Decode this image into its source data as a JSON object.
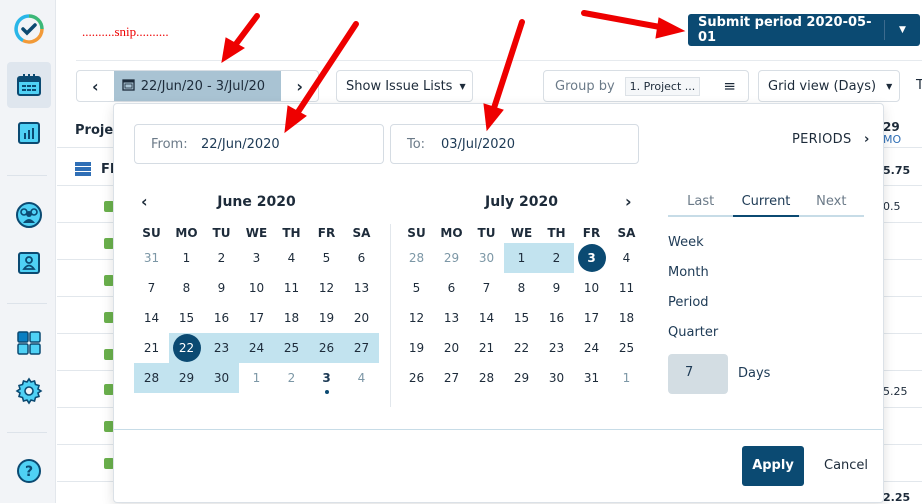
{
  "sidebar": {
    "items": [
      {
        "name": "logo",
        "icon": "check-circle-logo"
      },
      {
        "name": "calendar",
        "icon": "calendar-icon",
        "active": true
      },
      {
        "name": "reports",
        "icon": "bar-chart-icon"
      },
      {
        "name": "teams",
        "icon": "team-icon"
      },
      {
        "name": "profile",
        "icon": "user-card-icon"
      },
      {
        "name": "apps",
        "icon": "grid-icon"
      },
      {
        "name": "settings",
        "icon": "gear-icon"
      },
      {
        "name": "help",
        "icon": "help-icon"
      }
    ]
  },
  "annotation": {
    "snip": "..........snip.........."
  },
  "header": {
    "submit_label": "Submit period 2020-05-01"
  },
  "toolbar": {
    "date_range": "22/Jun/20 - 3/Jul/20",
    "show_issue_lists": "Show Issue Lists",
    "group_by_label": "Group by",
    "group_by_value": "1. Project ...",
    "grid_view": "Grid view (Days)",
    "truncated": "T"
  },
  "table": {
    "header_project": "Projec",
    "row_group": "FI",
    "col_header_day": "29",
    "col_header_dow": "MO",
    "values": [
      "5.75",
      "0.5",
      "5.25",
      "2.25"
    ]
  },
  "popup": {
    "from_label": "From:",
    "from_value": "22/Jun/2020",
    "to_label": "To:",
    "to_value": "03/Jul/2020",
    "periods_label": "PERIODS",
    "weekdays": [
      "SU",
      "MO",
      "TU",
      "WE",
      "TH",
      "FR",
      "SA"
    ],
    "left_month": "June 2020",
    "right_month": "July 2020",
    "left_days": [
      [
        "31",
        "1",
        "2",
        "3",
        "4",
        "5",
        "6"
      ],
      [
        "7",
        "8",
        "9",
        "10",
        "11",
        "12",
        "13"
      ],
      [
        "14",
        "15",
        "16",
        "17",
        "18",
        "19",
        "20"
      ],
      [
        "21",
        "22",
        "23",
        "24",
        "25",
        "26",
        "27"
      ],
      [
        "28",
        "29",
        "30",
        "1",
        "2",
        "3",
        "4"
      ]
    ],
    "right_days": [
      [
        "28",
        "29",
        "30",
        "1",
        "2",
        "3",
        "4"
      ],
      [
        "5",
        "6",
        "7",
        "8",
        "9",
        "10",
        "11"
      ],
      [
        "12",
        "13",
        "14",
        "15",
        "16",
        "17",
        "18"
      ],
      [
        "19",
        "20",
        "21",
        "22",
        "23",
        "24",
        "25"
      ],
      [
        "26",
        "27",
        "28",
        "29",
        "30",
        "31",
        "1"
      ]
    ],
    "period_tabs": [
      "Last",
      "Current",
      "Next"
    ],
    "active_tab": "Current",
    "period_options": [
      "Week",
      "Month",
      "Period",
      "Quarter"
    ],
    "days_value": "7",
    "days_label": "Days",
    "apply_label": "Apply",
    "cancel_label": "Cancel"
  },
  "colors": {
    "primary": "#0b4a72",
    "range": "#c2e3ef",
    "annotation_arrow": "#e00000"
  }
}
